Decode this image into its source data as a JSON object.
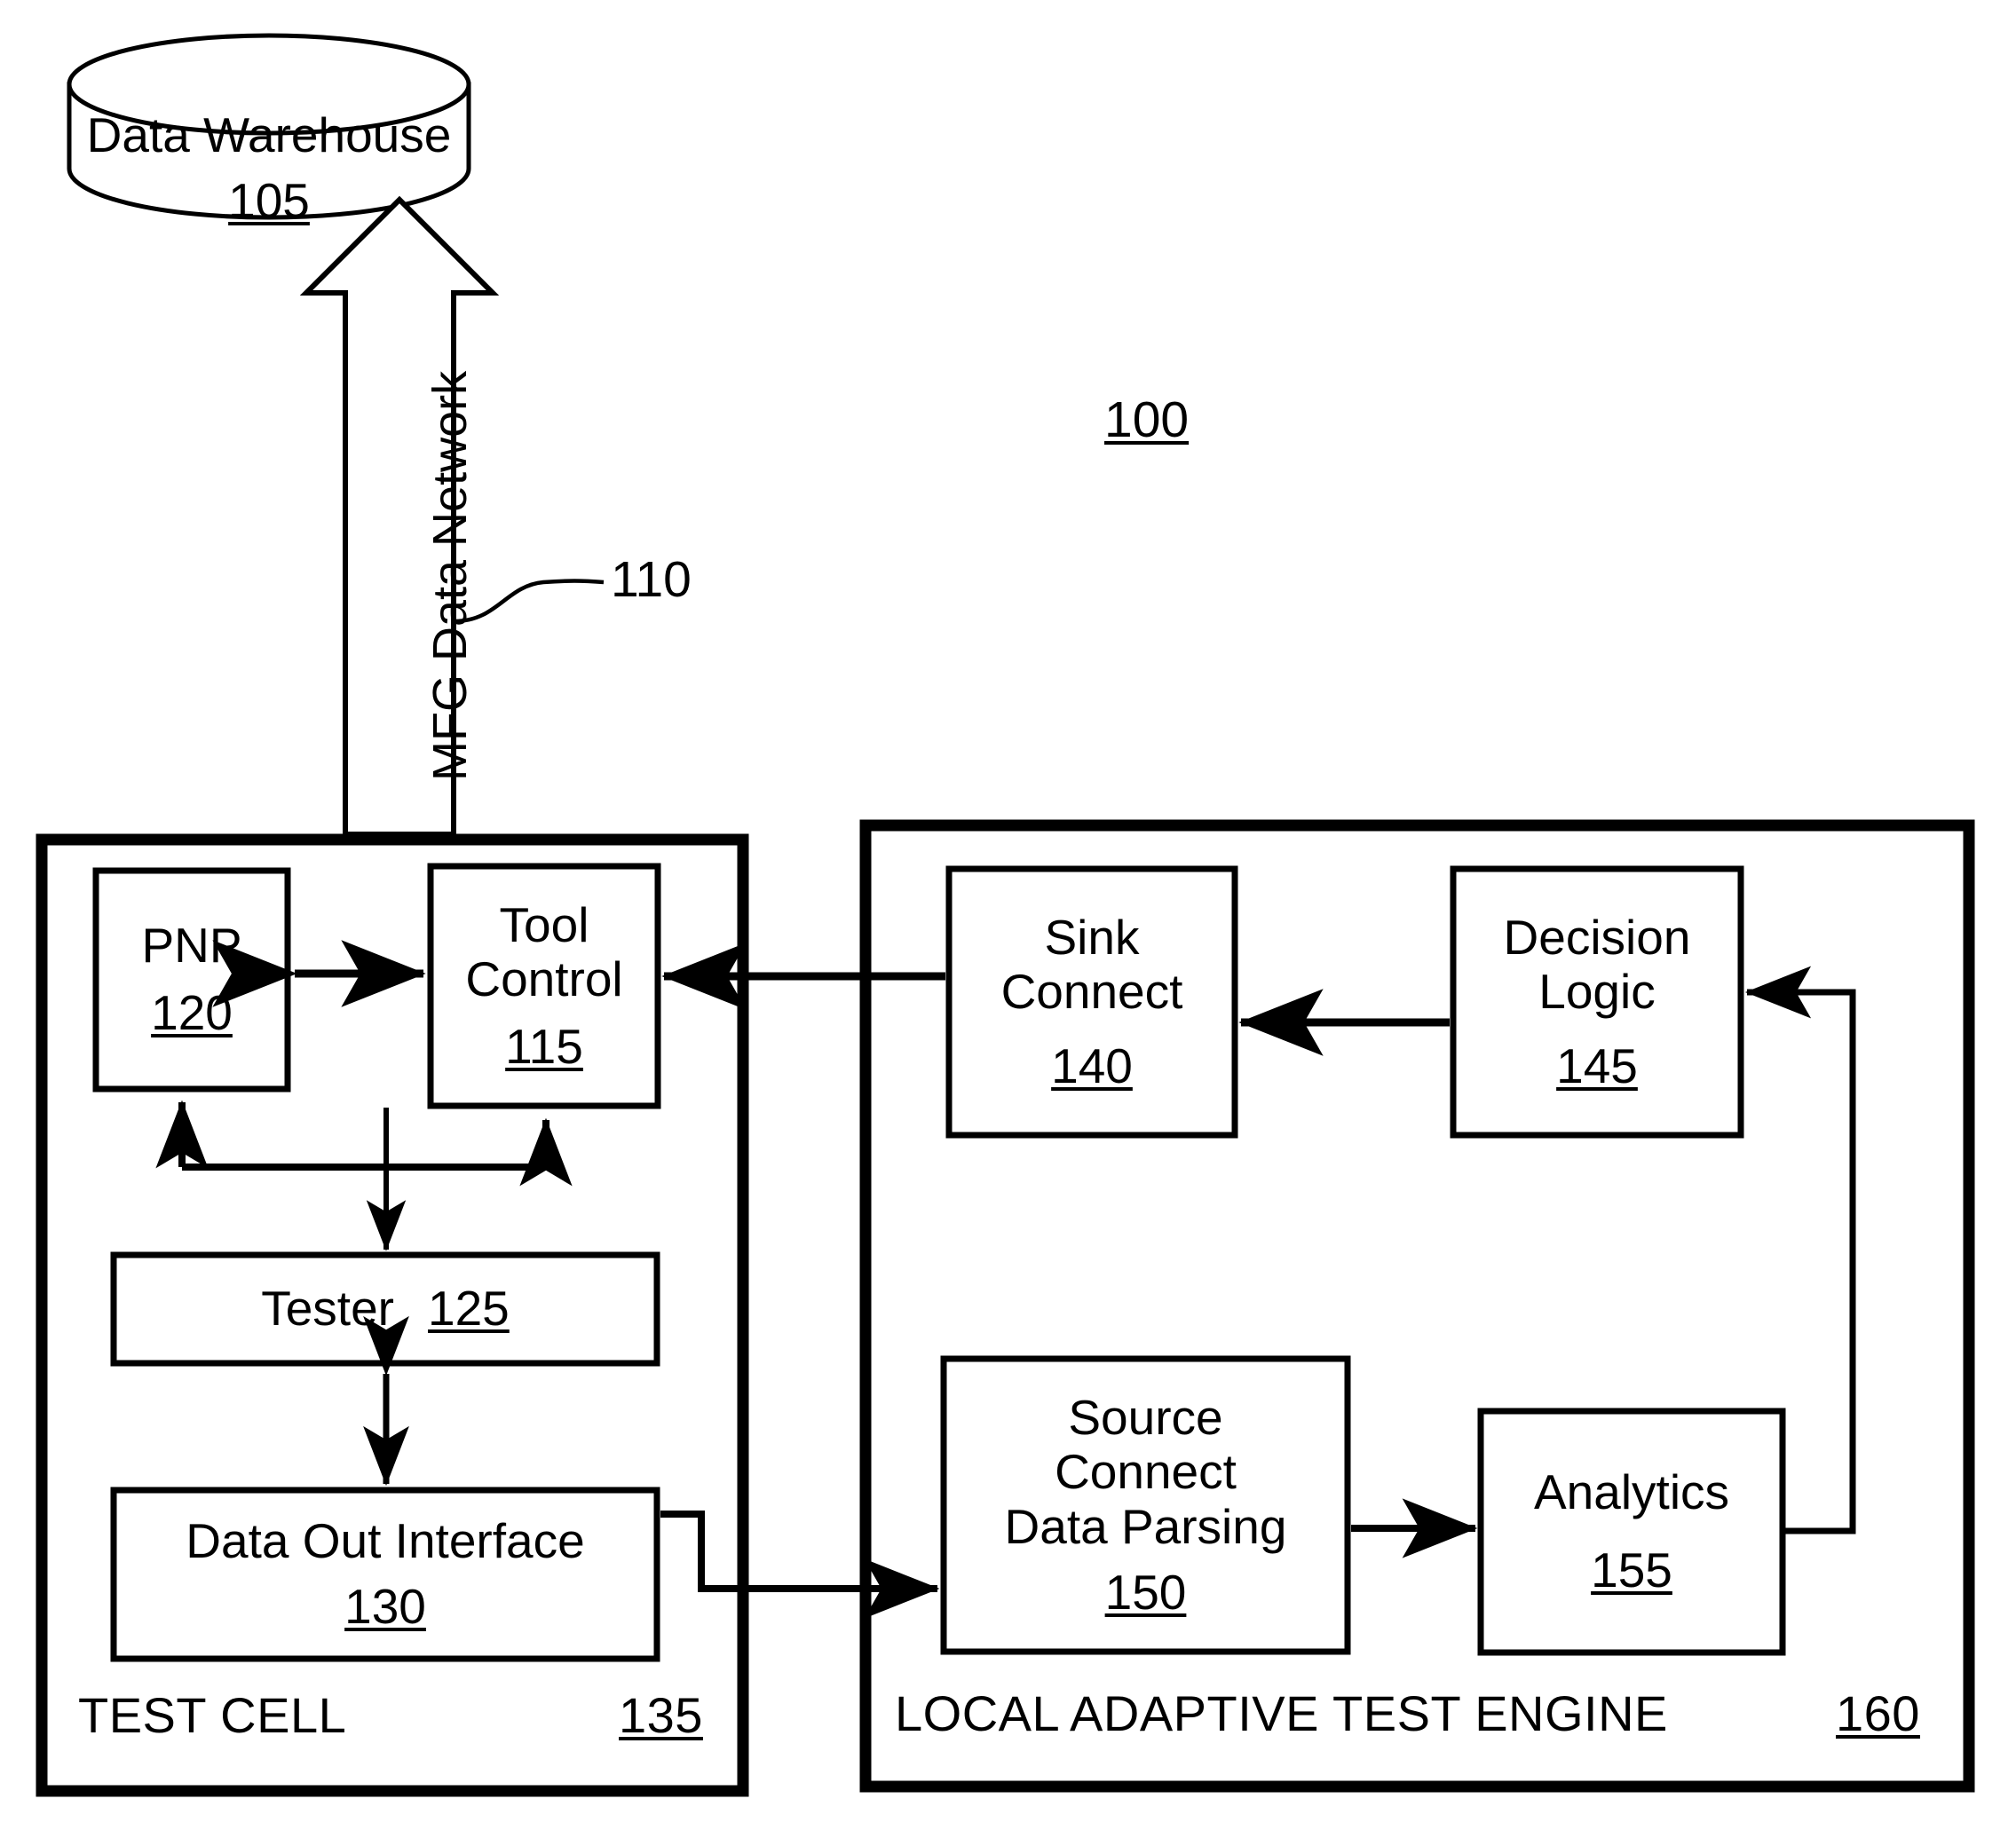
{
  "figure": {
    "number": "100",
    "network_label": "MFG Data Network",
    "network_ref": "110"
  },
  "warehouse": {
    "name": "Data Warehouse",
    "ref": "105"
  },
  "test_cell": {
    "caption": "TEST CELL",
    "ref": "135",
    "blocks": [
      {
        "name": "PNP",
        "ref": "120"
      },
      {
        "name": "Tool\nControl",
        "ref": "115"
      },
      {
        "name": "Tester",
        "ref": "125",
        "inline": true
      },
      {
        "name": "Data Out Interface",
        "ref": "130"
      }
    ]
  },
  "test_engine": {
    "caption": "LOCAL ADAPTIVE TEST ENGINE",
    "ref": "160",
    "blocks": [
      {
        "name": "Sink\nConnect",
        "ref": "140"
      },
      {
        "name": "Decision\nLogic",
        "ref": "145"
      },
      {
        "name": "Source\nConnect\nData Parsing",
        "ref": "150"
      },
      {
        "name": "Analytics",
        "ref": "155"
      }
    ]
  },
  "colors": {
    "stroke": "#000000",
    "background": "#ffffff"
  }
}
